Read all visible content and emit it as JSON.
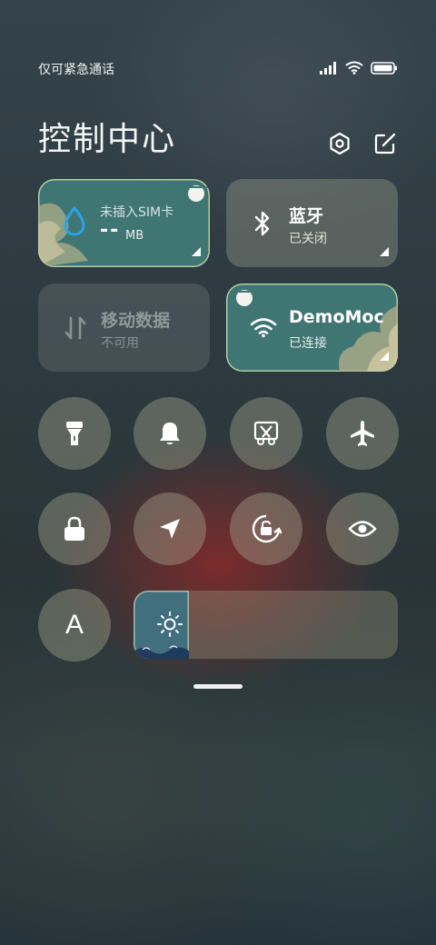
{
  "status_bar": {
    "carrier_text": "仅可紧急通话",
    "icons": [
      "signal-icon",
      "wifi-icon",
      "battery-icon"
    ]
  },
  "header": {
    "title": "控制中心",
    "actions": [
      "settings-icon",
      "edit-icon"
    ]
  },
  "tiles": {
    "data_usage": {
      "label": "未插入SIM卡",
      "value": "--",
      "unit": "MB",
      "icon": "water-drop-icon"
    },
    "bluetooth": {
      "label": "蓝牙",
      "status": "已关闭",
      "icon": "bluetooth-icon"
    },
    "mobile_data": {
      "label": "移动数据",
      "status": "不可用",
      "icon": "mobile-data-icon"
    },
    "wifi": {
      "label": "DemoMoc",
      "status": "已连接",
      "icon": "wifi-icon"
    }
  },
  "toggles_row1": [
    "flashlight-icon",
    "bell-icon",
    "screenshot-icon",
    "airplane-icon"
  ],
  "toggles_row2": [
    "lock-icon",
    "location-icon",
    "rotation-lock-icon",
    "eye-icon"
  ],
  "font_button": {
    "label": "A"
  },
  "brightness": {
    "icon": "sun-icon",
    "level": 0.21
  },
  "colors": {
    "accent_teal": "#3f7573",
    "tile_gray": "#7a7a6e",
    "red_glow": "#963030"
  }
}
